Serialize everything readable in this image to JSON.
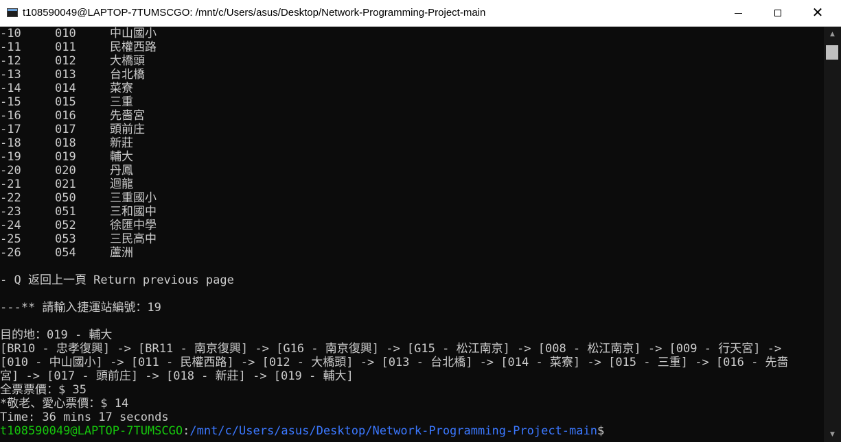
{
  "window": {
    "title": "t108590049@LAPTOP-7TUMSCGO: /mnt/c/Users/asus/Desktop/Network-Programming-Project-main",
    "minimize_icon": "minimize-icon",
    "maximize_icon": "maximize-icon",
    "close_icon": "close-icon",
    "close_glyph": "✕"
  },
  "terminal": {
    "stations": [
      {
        "idx": "-10",
        "code": "010",
        "name": "中山國小"
      },
      {
        "idx": "-11",
        "code": "011",
        "name": "民權西路"
      },
      {
        "idx": "-12",
        "code": "012",
        "name": "大橋頭"
      },
      {
        "idx": "-13",
        "code": "013",
        "name": "台北橋"
      },
      {
        "idx": "-14",
        "code": "014",
        "name": "菜寮"
      },
      {
        "idx": "-15",
        "code": "015",
        "name": "三重"
      },
      {
        "idx": "-16",
        "code": "016",
        "name": "先嗇宮"
      },
      {
        "idx": "-17",
        "code": "017",
        "name": "頭前庄"
      },
      {
        "idx": "-18",
        "code": "018",
        "name": "新莊"
      },
      {
        "idx": "-19",
        "code": "019",
        "name": "輔大"
      },
      {
        "idx": "-20",
        "code": "020",
        "name": "丹鳳"
      },
      {
        "idx": "-21",
        "code": "021",
        "name": "迴龍"
      },
      {
        "idx": "-22",
        "code": "050",
        "name": "三重國小"
      },
      {
        "idx": "-23",
        "code": "051",
        "name": "三和國中"
      },
      {
        "idx": "-24",
        "code": "052",
        "name": "徐匯中學"
      },
      {
        "idx": "-25",
        "code": "053",
        "name": "三民高中"
      },
      {
        "idx": "-26",
        "code": "054",
        "name": "蘆洲"
      }
    ],
    "return_option": "- Q 返回上一頁 Return previous page",
    "input_prompt": "---** 請輸入捷運站編號：19",
    "destination": "目的地：019 - 輔大",
    "route_lines": [
      "[BR10 - 忠孝復興] -> [BR11 - 南京復興] -> [G16 - 南京復興] -> [G15 - 松江南京] -> [008 - 松江南京] -> [009 - 行天宮] ->",
      "[010 - 中山國小] -> [011 - 民權西路] -> [012 - 大橋頭] -> [013 - 台北橋] -> [014 - 菜寮] -> [015 - 三重] -> [016 - 先嗇",
      "宮] -> [017 - 頭前庄] -> [018 - 新莊] -> [019 - 輔大]"
    ],
    "full_fare": "全票票價：$ 35",
    "concession_fare": "*敬老、愛心票價：$ 14",
    "travel_time": "Time: 36 mins 17 seconds",
    "prompt": {
      "user_host": "t108590049@LAPTOP-7TUMSCGO",
      "separator": ":",
      "path": "/mnt/c/Users/asus/Desktop/Network-Programming-Project-main",
      "symbol": "$"
    }
  },
  "scrollbar": {
    "up_icon": "scroll-up-arrow-icon",
    "down_icon": "scroll-down-arrow-icon",
    "up_glyph": "▲",
    "down_glyph": "▼"
  },
  "colors": {
    "background": "#0c0c0c",
    "text": "#cccccc",
    "prompt_user": "#16c60c",
    "prompt_path": "#3b78ff"
  }
}
